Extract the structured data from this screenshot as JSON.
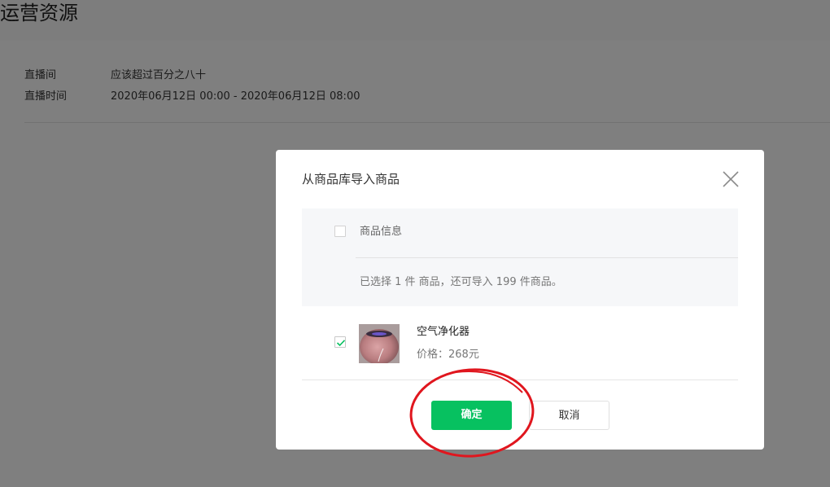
{
  "page": {
    "title": "运营资源"
  },
  "info": {
    "room_label": "直播间",
    "room_value": "应该超过百分之八十",
    "time_label": "直播时间",
    "time_value": "2020年06月12日 00:00 - 2020年06月12日 08:00"
  },
  "dialog": {
    "title": "从商品库导入商品",
    "header_label": "商品信息",
    "header_checked": false,
    "summary": "已选择 1 件 商品，还可导入 199 件商品。",
    "product": {
      "name": "空气净化器",
      "price": "价格：268元",
      "checked": true
    },
    "confirm_label": "确定",
    "cancel_label": "取消"
  },
  "colors": {
    "accent": "#07c160",
    "annotation": "#e0161e",
    "overlay": "rgba(0,0,0,0.5)"
  },
  "icons": {
    "close": "close-icon",
    "check": "check-icon"
  }
}
